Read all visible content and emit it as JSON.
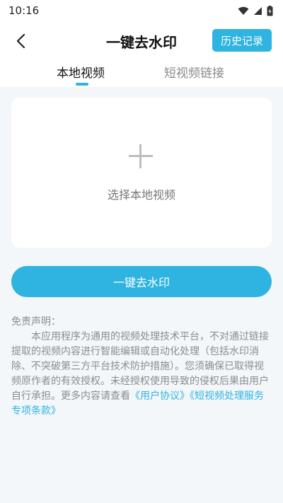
{
  "status_bar": {
    "time": "10:16"
  },
  "header": {
    "title": "一键去水印",
    "history_label": "历史记录"
  },
  "tabs": [
    {
      "label": "本地视频"
    },
    {
      "label": "短视频链接"
    }
  ],
  "upload": {
    "label": "选择本地视频"
  },
  "action": {
    "label": "一键去水印"
  },
  "disclaimer": {
    "heading": "免责声明：",
    "body": "本应用程序为通用的视频处理技术平台，不对通过链接提取的视频内容进行智能编辑或自动化处理（包括水印消除、不突破第三方平台技术防护措施）。您须确保已取得视频原作者的有效授权。未经授权使用导致的侵权后果由用户自行承担。更多内容请查看",
    "link_user": "《用户协议》",
    "link_terms": "《短视频处理服务专项条款》"
  },
  "colors": {
    "accent": "#2fb3e0",
    "background": "#f3f7fa"
  }
}
